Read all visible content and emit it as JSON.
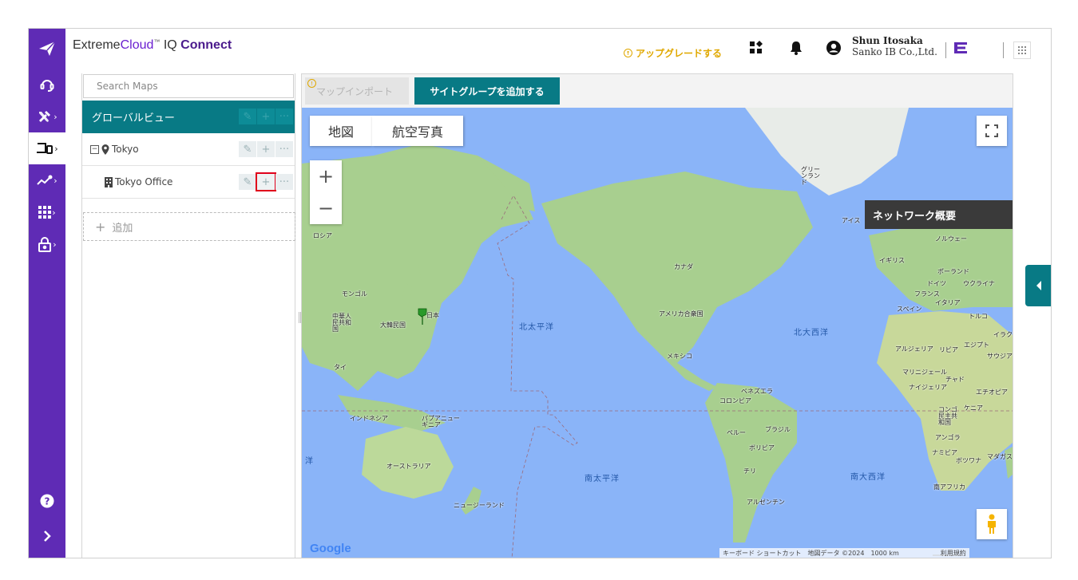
{
  "header": {
    "brand_prefix": "Extreme",
    "brand_cloud": "Cloud",
    "brand_tm": "™",
    "brand_iq": " IQ ",
    "brand_connect": "Connect",
    "upgrade_label": "アップグレードする",
    "user_name": "Shun Itosaka",
    "user_org": "Sanko IB Co.,Ltd."
  },
  "nav": {
    "icons": [
      "support-icon",
      "tools-icon",
      "devices-icon",
      "analytics-icon",
      "apps-icon",
      "security-icon",
      "help-icon",
      "expand-icon"
    ]
  },
  "tree": {
    "search_placeholder": "Search Maps",
    "global_label": "グローバルビュー",
    "site_label": "Tokyo",
    "building_label": "Tokyo Office",
    "add_label": "追加"
  },
  "map_toolbar": {
    "import_label": "マップインポート",
    "add_group_label": "サイトグループを追加する"
  },
  "map": {
    "type_map": "地図",
    "type_satellite": "航空写真",
    "network_overview": "ネットワーク概要",
    "zoom_in": "+",
    "zoom_out": "−",
    "labels": {
      "greenland": "グリーンランド",
      "iceland": "アイス",
      "norway": "ノルウェー",
      "russia": "ロシア",
      "uk": "イギリス",
      "poland": "ポーランド",
      "germany": "ドイツ",
      "ukraine": "ウクライナ",
      "france": "フランス",
      "italy": "イタリア",
      "spain": "スペイン",
      "turkey": "トルコ",
      "canada": "カナダ",
      "mongolia": "モンゴル",
      "china": "中華人民共和国",
      "korea": "大韓民国",
      "japan": "日本",
      "usa": "アメリカ合衆国",
      "mexico": "メキシコ",
      "thailand": "タイ",
      "iraq": "イラク",
      "algeria": "アルジェリア",
      "libya": "リビア",
      "egypt": "エジプト",
      "saudi": "サウジアラ",
      "mali": "マリ",
      "niger": "ニジェール",
      "chad": "チャド",
      "nigeria": "ナイジェリア",
      "ethiopia": "エチオピア",
      "venezuela": "ベネズエラ",
      "colombia": "コロンビア",
      "indonesia": "インドネシア",
      "png": "パプアニューギニア",
      "congo": "コンゴ民主共和国",
      "kenya": "ケニア",
      "peru": "ペルー",
      "brazil": "ブラジル",
      "bolivia": "ボリビア",
      "angola": "アンゴラ",
      "namibia": "ナミビア",
      "botswana": "ボツワナ",
      "madagascar": "マダガス",
      "australia": "オーストラリア",
      "chile": "チリ",
      "south_africa": "南アフリカ",
      "nz": "ニュージーランド",
      "argentina": "アルゼンチン"
    },
    "oceans": {
      "north_pacific": "北太平洋",
      "north_atlantic": "北大西洋",
      "south_pacific": "南太平洋",
      "south_atlantic": "南大西洋",
      "indian_fragment": "洋"
    },
    "google_logo": "Google",
    "attribution": {
      "shortcuts": "キーボード ショートカット",
      "data": "地図データ ©2024",
      "scale": "1000 km",
      "terms": "利用規約"
    }
  },
  "colors": {
    "nav_purple": "#5f2bb5",
    "teal": "#087a85",
    "upgrade_gold": "#e0a800",
    "highlight_red": "#e0001b",
    "ocean": "#8ab4f8",
    "land": "#a8cf8f"
  }
}
